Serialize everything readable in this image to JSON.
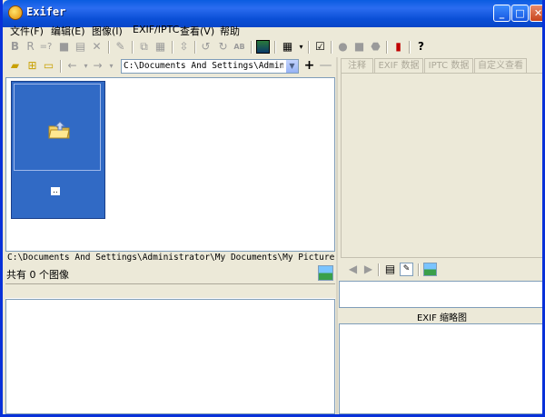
{
  "window": {
    "title": "Exifer"
  },
  "menu": [
    "文件(F)",
    "编辑(E)",
    "图像(I)",
    "EXIF/IPTC",
    "查看(V)",
    "帮助"
  ],
  "toolbar_icons": [
    "bold-icon",
    "red-eye-icon",
    "rename-icon",
    "stop-icon",
    "open-folder-icon",
    "delete-icon",
    "edit-icon",
    "copy-icon",
    "grid-icon",
    "resize-icon",
    "rotate-left-icon",
    "rotate-right-icon",
    "lossless-icon",
    "picture-icon",
    "view-icon",
    "view-dropdown-icon",
    "checklist-icon",
    "tool-icon",
    "tool-icon-2",
    "tool-icon-3",
    "phone-icon",
    "help-icon"
  ],
  "path": {
    "combo_value": "C:\\Documents And Settings\\Administrat",
    "full_path": "C:\\Documents And Settings\\Administrator\\My Documents\\My Pictures\\"
  },
  "thumbnail": {
    "label": ".."
  },
  "status": {
    "text": "共有 0 个图像"
  },
  "tabs": [
    "注释",
    "EXIF 数据",
    "IPTC 数据",
    "自定义查看"
  ],
  "exif_thumbnail_label": "EXIF 缩略图",
  "colors": {
    "title_bar": "#0a5ce0",
    "window_bg": "#ece9d8",
    "selection": "#316ac5"
  }
}
